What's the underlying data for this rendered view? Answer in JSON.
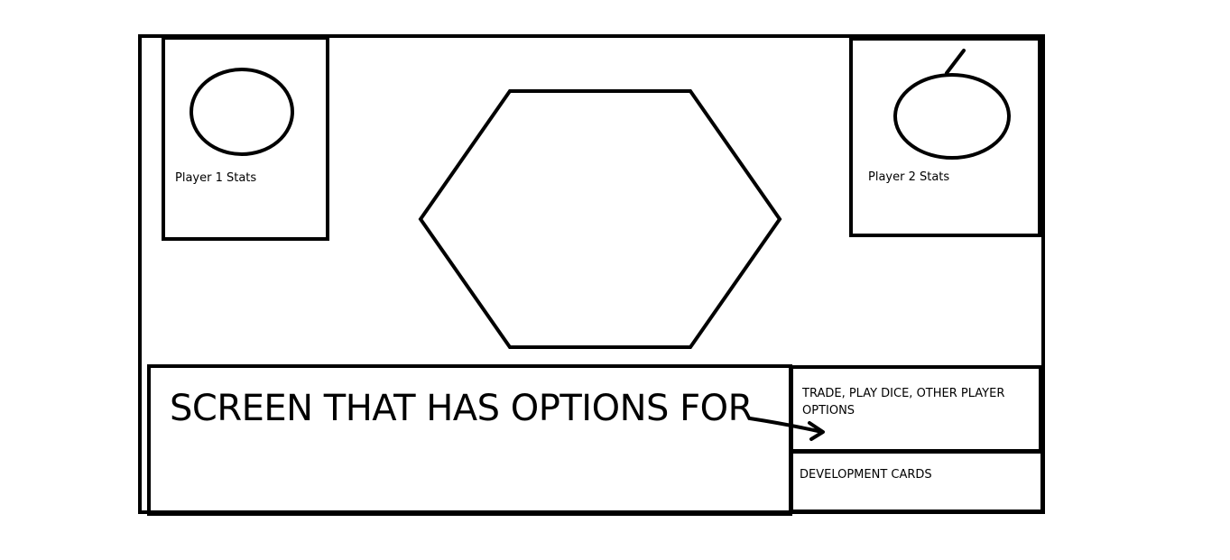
{
  "player1": {
    "label": "Player 1 Stats",
    "avatar_icon": "avatar-circle"
  },
  "player2": {
    "label": "Player 2 Stats",
    "avatar_icon": "avatar-circle-with-stick"
  },
  "board": {
    "shape": "hexagon"
  },
  "options_screen": {
    "text": "SCREEN THAT HAS OPTIONS FOR"
  },
  "trade_panel": {
    "text": "TRADE, PLAY DICE, OTHER PLAYER OPTIONS"
  },
  "dev_cards_panel": {
    "text": "DEVELOPMENT CARDS"
  },
  "arrow": {
    "icon": "arrow-right-icon"
  },
  "colors": {
    "stroke": "#000000",
    "background": "#ffffff"
  }
}
